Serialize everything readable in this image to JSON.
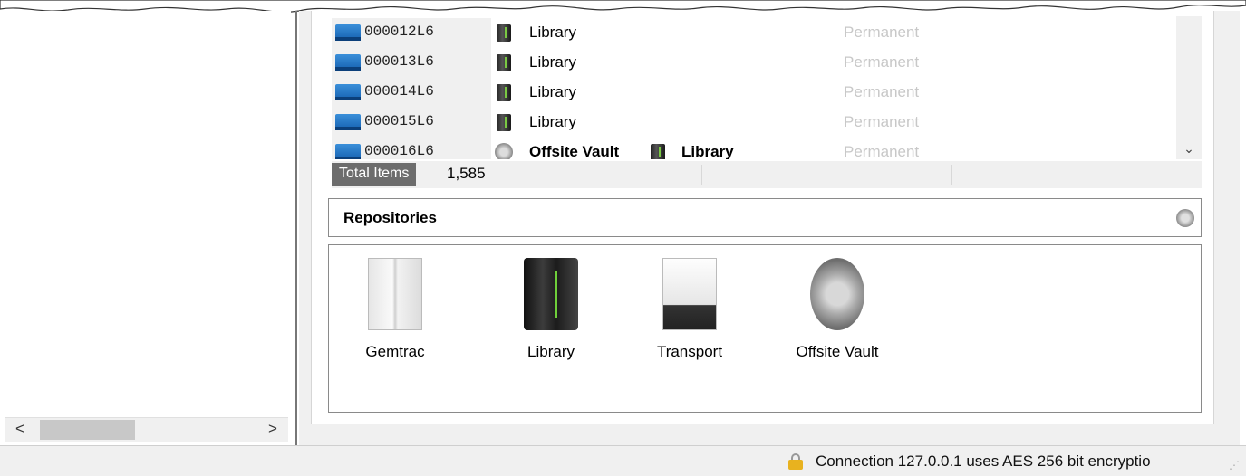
{
  "media_list": {
    "rows": [
      {
        "media_id": "000012L6",
        "location_icon": "library-icon",
        "location": "Library",
        "retention": "Permanent"
      },
      {
        "media_id": "000013L6",
        "location_icon": "library-icon",
        "location": "Library",
        "retention": "Permanent"
      },
      {
        "media_id": "000014L6",
        "location_icon": "library-icon",
        "location": "Library",
        "retention": "Permanent"
      },
      {
        "media_id": "000015L6",
        "location_icon": "library-icon",
        "location": "Library",
        "retention": "Permanent"
      },
      {
        "media_id": "000016L6",
        "location_icon": "vault-icon",
        "location": "Offsite Vault",
        "next_location_icon": "library-icon",
        "next_location": "Library",
        "retention": "Permanent"
      }
    ],
    "scroll_down_glyph": "⌄"
  },
  "summary": {
    "total_label": "Total Items",
    "total_value": "1,585"
  },
  "repositories": {
    "title": "Repositories",
    "header_icon": "vault-icon",
    "items": [
      {
        "label": "Gemtrac",
        "icon": "gemtrac-cabinet-icon"
      },
      {
        "label": "Library",
        "icon": "tape-library-icon"
      },
      {
        "label": "Transport",
        "icon": "transport-truck-icon"
      },
      {
        "label": "Offsite Vault",
        "icon": "vault-icon"
      }
    ]
  },
  "left_scroll": {
    "left_glyph": "<",
    "right_glyph": ">"
  },
  "status_bar": {
    "connection_text": "Connection 127.0.0.1 uses AES 256 bit encryptio",
    "lock_icon": "lock-icon",
    "grip": "⋰"
  }
}
